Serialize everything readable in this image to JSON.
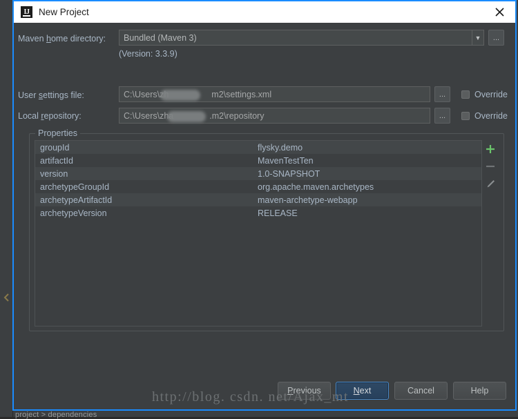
{
  "window": {
    "title": "New Project",
    "app_icon": "intellij-idea-icon",
    "close_icon": "close-icon",
    "border_color": "#1a8cff",
    "titlebar_bg": "#ffffff",
    "body_bg": "#3c3f41"
  },
  "ide": {
    "bottom_breadcrumb": "project  >  dependencies",
    "collapse_icon": "chevron-left-icon"
  },
  "form": {
    "maven_home": {
      "label_pre": "Maven ",
      "label_mnemonic": "h",
      "label_post": "ome directory:",
      "value": "Bundled (Maven 3)",
      "dropdown_icon": "chevron-down-icon",
      "browse_label": "...",
      "version_note": "(Version: 3.3.9)"
    },
    "user_settings": {
      "label_pre": "User ",
      "label_mnemonic": "s",
      "label_post": "ettings file:",
      "value_left": "C:\\Users\\zh",
      "value_right": "m2\\settings.xml",
      "browse_label": "...",
      "override_label": "Override",
      "override_checked": false
    },
    "local_repository": {
      "label_pre": "Local ",
      "label_mnemonic": "r",
      "label_post": "epository:",
      "value_left": "C:\\Users\\zha",
      "value_right": ".m2\\repository",
      "browse_label": "...",
      "override_label": "Override",
      "override_checked": false
    }
  },
  "properties": {
    "legend": "Properties",
    "rows": [
      {
        "key": "groupId",
        "value": "flysky.demo"
      },
      {
        "key": "artifactId",
        "value": "MavenTestTen"
      },
      {
        "key": "version",
        "value": "1.0-SNAPSHOT"
      },
      {
        "key": "archetypeGroupId",
        "value": "org.apache.maven.archetypes"
      },
      {
        "key": "archetypeArtifactId",
        "value": "maven-archetype-webapp"
      },
      {
        "key": "archetypeVersion",
        "value": "RELEASE"
      }
    ],
    "toolbar": {
      "add_icon": "plus-icon",
      "add_color": "#6ac46a",
      "remove_icon": "minus-icon",
      "edit_icon": "pencil-icon"
    }
  },
  "buttons": {
    "previous": {
      "label_pre": "",
      "label_mnemonic": "P",
      "label_post": "revious"
    },
    "next": {
      "label_pre": "",
      "label_mnemonic": "N",
      "label_post": "ext",
      "is_default": true
    },
    "cancel": {
      "label": "Cancel"
    },
    "help": {
      "label": "Help"
    }
  },
  "watermark": {
    "text": "http://blog. csdn. net/Ajax_mt"
  }
}
